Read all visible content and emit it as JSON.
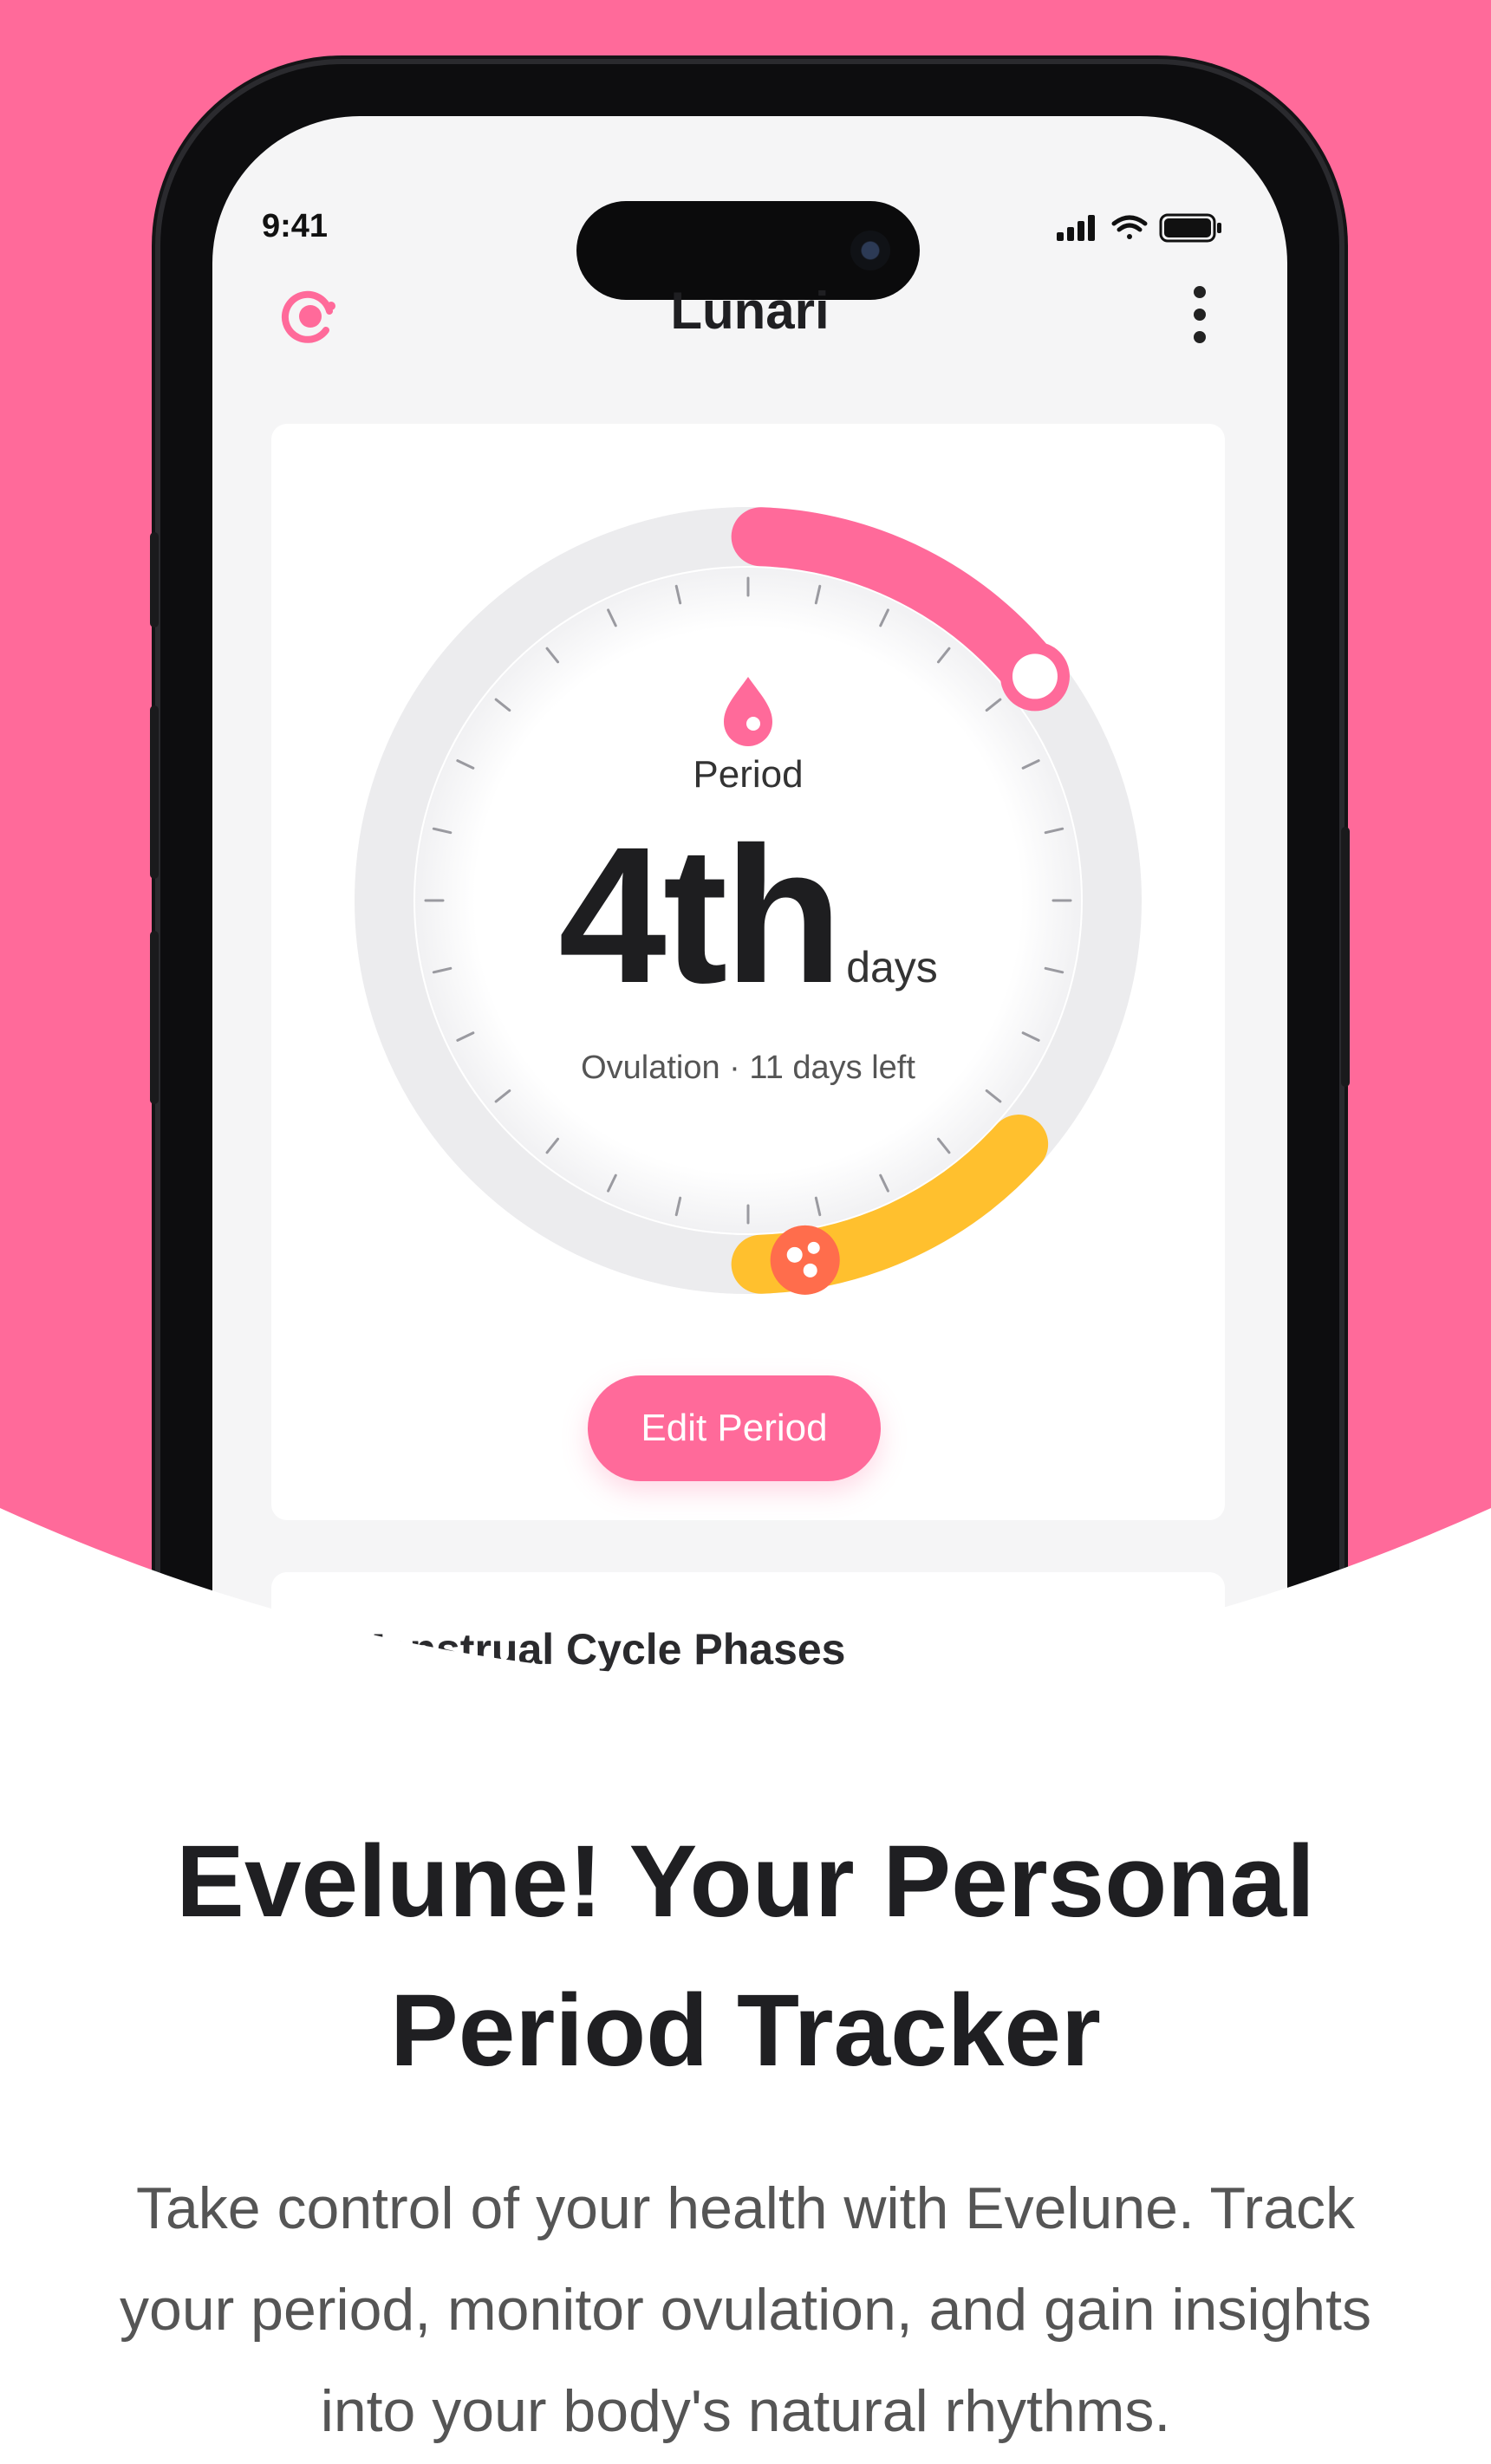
{
  "colors": {
    "accent_pink": "#ff6a9a",
    "ovulation_yellow": "#ffc02e",
    "text_dark": "#1f1f22"
  },
  "status_bar": {
    "time": "9:41",
    "icons": [
      "signal-icon",
      "wifi-icon",
      "battery-icon"
    ]
  },
  "header": {
    "logo_icon": "lunari-logo-icon",
    "title": "Lunari",
    "menu_icon": "more-vertical-icon"
  },
  "cycle_card": {
    "phase_icon": "blood-drop-icon",
    "phase_label": "Period",
    "day_value": "4th",
    "day_unit": "days",
    "ovulation_text": "Ovulation · 11 days left",
    "edit_button": "Edit Period"
  },
  "phases_card": {
    "title": "Menstrual Cycle Phases"
  },
  "marketing": {
    "headline": "Evelune! Your Personal Period Tracker",
    "subtext": "Take control of your health with Evelune. Track your period, monitor ovulation, and gain insights into your body's natural rhythms."
  }
}
